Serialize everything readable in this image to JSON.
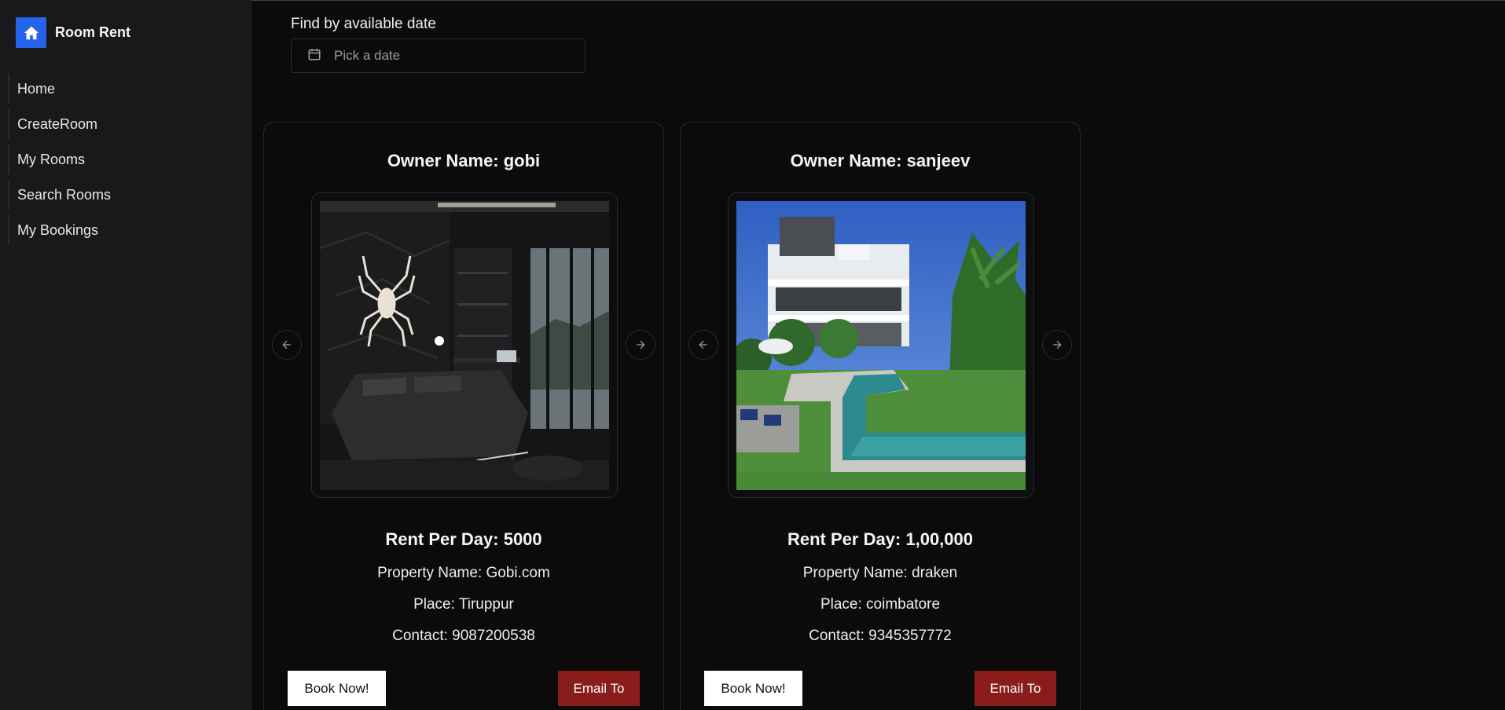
{
  "app": {
    "title": "Room Rent",
    "accent_color": "#2563eb",
    "logo_icon": "home-icon"
  },
  "sidebar": {
    "items": [
      {
        "label": "Home"
      },
      {
        "label": "CreateRoom"
      },
      {
        "label": "My Rooms"
      },
      {
        "label": "Search Rooms"
      },
      {
        "label": "My Bookings"
      }
    ]
  },
  "filter": {
    "label": "Find by available date",
    "placeholder": "Pick a date",
    "icon": "calendar-icon"
  },
  "rooms": [
    {
      "owner": "Owner Name: gobi",
      "image": "dark bedroom with spider wall art",
      "rent": "Rent Per Day: 5000",
      "property": "Property Name: Gobi.com",
      "place": "Place: Tiruppur",
      "contact": "Contact: 9087200538",
      "book_label": "Book Now!",
      "email_label": "Email To"
    },
    {
      "owner": "Owner Name: sanjeev",
      "image": "villa with swimming pool and palm trees",
      "rent": "Rent Per Day: 1,00,000",
      "property": "Property Name: draken",
      "place": "Place: coimbatore",
      "contact": "Contact: 9345357772",
      "book_label": "Book Now!",
      "email_label": "Email To"
    }
  ],
  "colors": {
    "background": "#0b0b0c",
    "sidebar": "#19191b",
    "email_button": "#8b1c1c",
    "book_button": "#ffffff"
  }
}
